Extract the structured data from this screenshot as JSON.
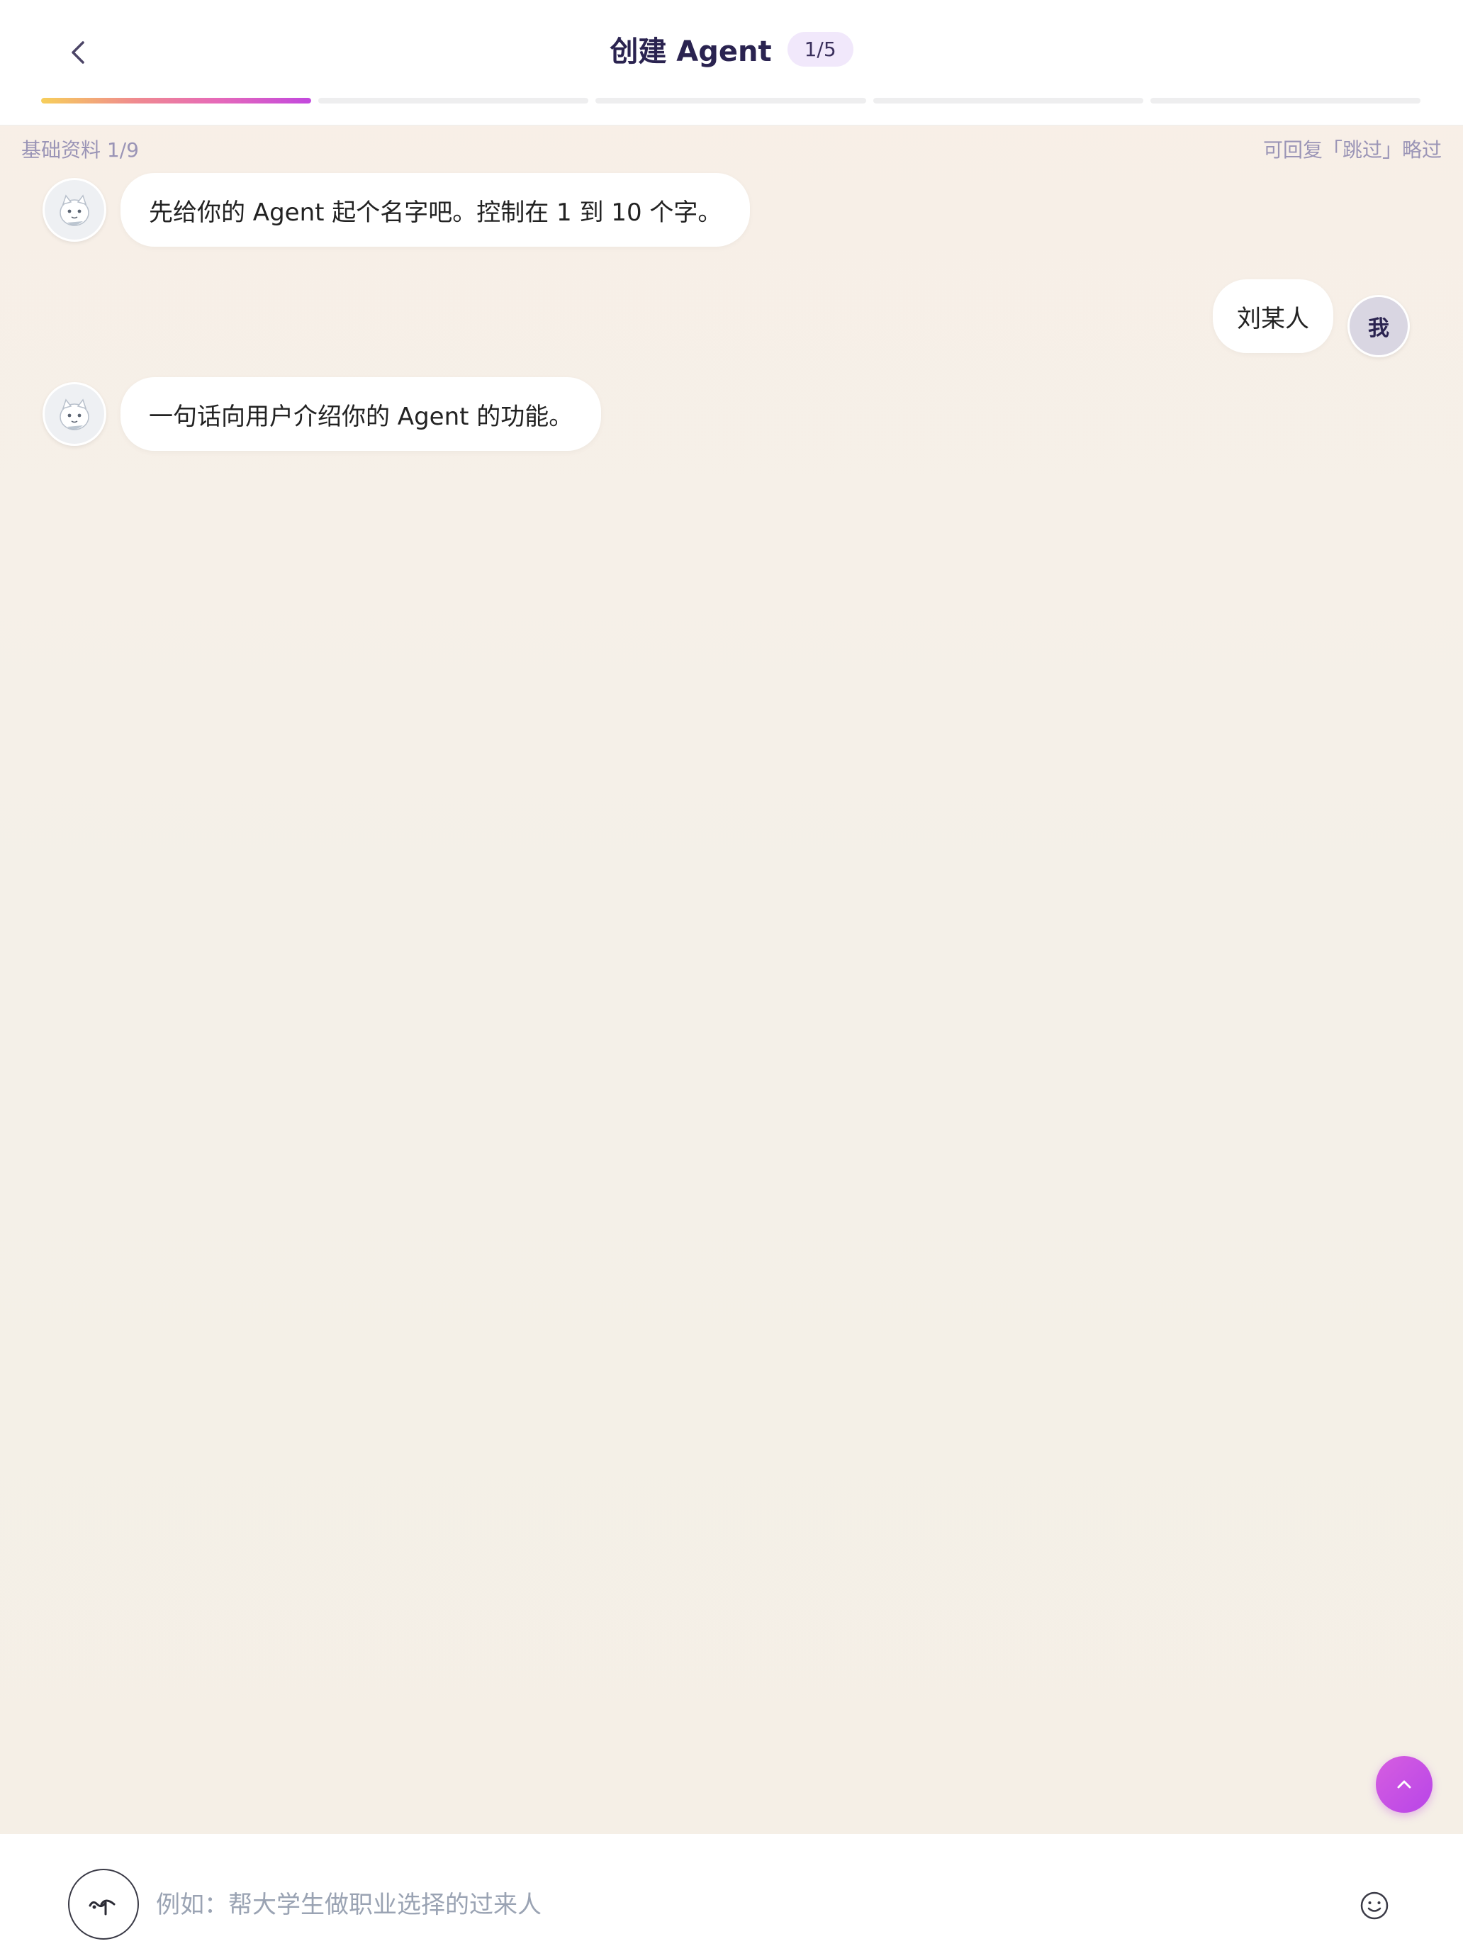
{
  "header": {
    "title": "创建 Agent",
    "step_badge": "1/5",
    "progress": {
      "segments": 5,
      "current_segment_fill": 1.0,
      "filled_segments": 1
    }
  },
  "substatus": {
    "left": "基础资料 1/9",
    "right": "可回复「跳过」略过"
  },
  "messages": [
    {
      "role": "bot",
      "text": "先给你的 Agent 起个名字吧。控制在 1 到 10 个字。"
    },
    {
      "role": "user",
      "text": "刘某人",
      "avatar_label": "我"
    },
    {
      "role": "bot",
      "text": "一句话向用户介绍你的 Agent 的功能。"
    }
  ],
  "input": {
    "placeholder": "例如：帮大学生做职业选择的过来人",
    "value": ""
  },
  "icons": {
    "back": "chevron-left-icon",
    "voice": "voice-icon",
    "emoji": "emoji-icon",
    "scroll_top": "chevron-up-icon",
    "bot_avatar": "bot-avatar-icon"
  },
  "colors": {
    "accent": "#c248de",
    "title": "#2a2350",
    "badge_bg": "#f1e8fb",
    "muted": "#9a94b6"
  }
}
